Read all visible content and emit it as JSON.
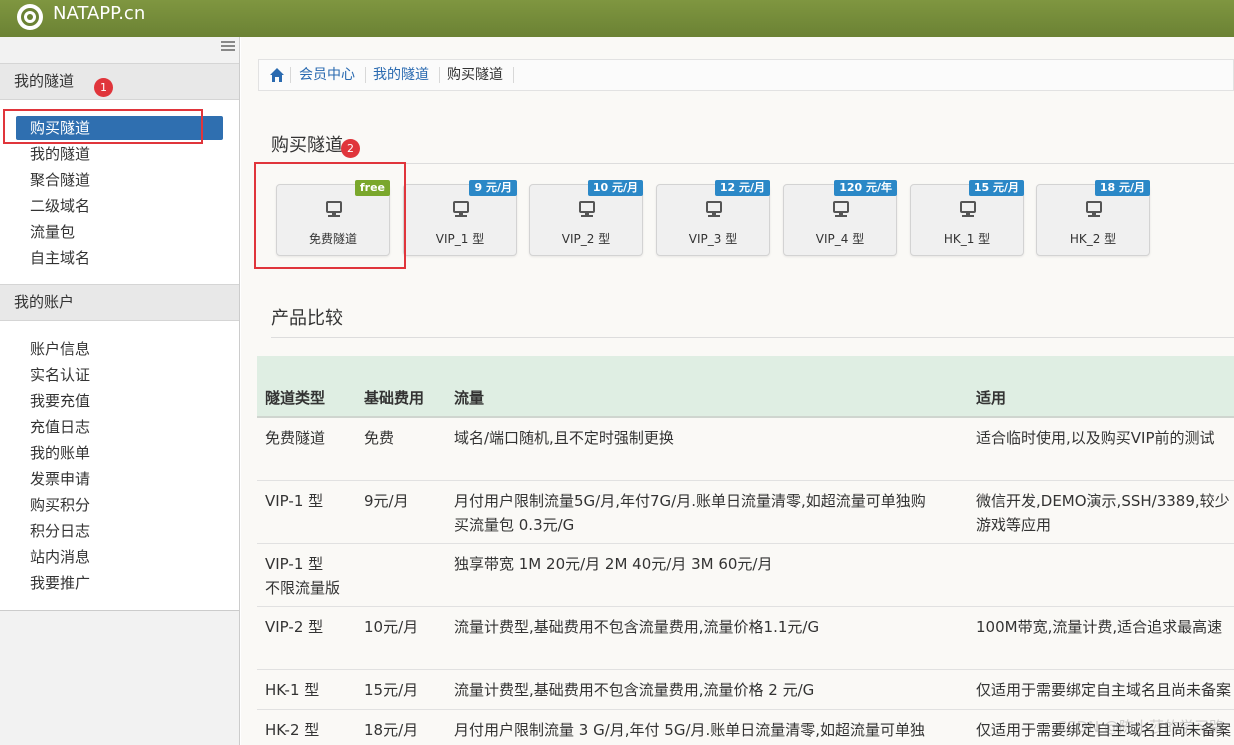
{
  "app": {
    "brand": "NATAPP.cn"
  },
  "sidebar": {
    "section1_title": "我的隧道",
    "section1_items": [
      "购买隧道",
      "我的隧道",
      "聚合隧道",
      "二级域名",
      "流量包",
      "自主域名"
    ],
    "section2_title": "我的账户",
    "section2_items": [
      "账户信息",
      "实名认证",
      "我要充值",
      "充值日志",
      "我的账单",
      "发票申请",
      "购买积分",
      "积分日志",
      "站内消息",
      "我要推广"
    ]
  },
  "annotations": {
    "marker1": "1",
    "marker2": "2"
  },
  "breadcrumb": [
    "会员中心",
    "我的隧道",
    "购买隧道"
  ],
  "buy_section": {
    "title": "购买隧道"
  },
  "plans": [
    {
      "label": "免费隧道",
      "tag": "free"
    },
    {
      "label": "VIP_1 型",
      "tag": "9 元/月"
    },
    {
      "label": "VIP_2 型",
      "tag": "10 元/月"
    },
    {
      "label": "VIP_3 型",
      "tag": "12 元/月"
    },
    {
      "label": "VIP_4 型",
      "tag": "120 元/年"
    },
    {
      "label": "HK_1 型",
      "tag": "15 元/月"
    },
    {
      "label": "HK_2 型",
      "tag": "18 元/月"
    }
  ],
  "compare_section": {
    "title": "产品比较"
  },
  "table": {
    "headers": [
      "隧道类型",
      "基础费用",
      "流量",
      "适用"
    ],
    "rows": [
      {
        "type": [
          "免费隧道"
        ],
        "fee": "免费",
        "traffic": [
          "域名/端口随机,且不定时强制更换"
        ],
        "use": [
          "适合临时使用,以及购买VIP前的测试"
        ]
      },
      {
        "type": [
          "VIP-1 型"
        ],
        "fee": "9元/月",
        "traffic": [
          "月付用户限制流量5G/月,年付7G/月.账单日流量清零,如超流量可单独购",
          "买流量包 0.3元/G"
        ],
        "use": [
          "微信开发,DEMO演示,SSH/3389,较少",
          "游戏等应用"
        ]
      },
      {
        "type": [
          "VIP-1 型",
          "不限流量版"
        ],
        "fee": "",
        "traffic": [
          "独享带宽 1M 20元/月 2M 40元/月 3M 60元/月"
        ],
        "use": [
          ""
        ]
      },
      {
        "type": [
          "VIP-2 型"
        ],
        "fee": "10元/月",
        "traffic": [
          "流量计费型,基础费用不包含流量费用,流量价格1.1元/G"
        ],
        "use": [
          "100M带宽,流量计费,适合追求最高速"
        ]
      },
      {
        "type": [
          "HK-1 型"
        ],
        "fee": "15元/月",
        "traffic": [
          "流量计费型,基础费用不包含流量费用,流量价格 2 元/G"
        ],
        "use": [
          "仅适用于需要绑定自主域名且尚未备案"
        ]
      },
      {
        "type": [
          "HK-2 型"
        ],
        "fee": "18元/月",
        "traffic": [
          "月付用户限制流量 3 G/月,年付 5G/月.账单日流量清零,如超流量可单独"
        ],
        "use": [
          "仅适用于需要绑定自主域名且尚未备案"
        ]
      }
    ]
  },
  "watermark": "CSDN @陈小莎的学习路"
}
